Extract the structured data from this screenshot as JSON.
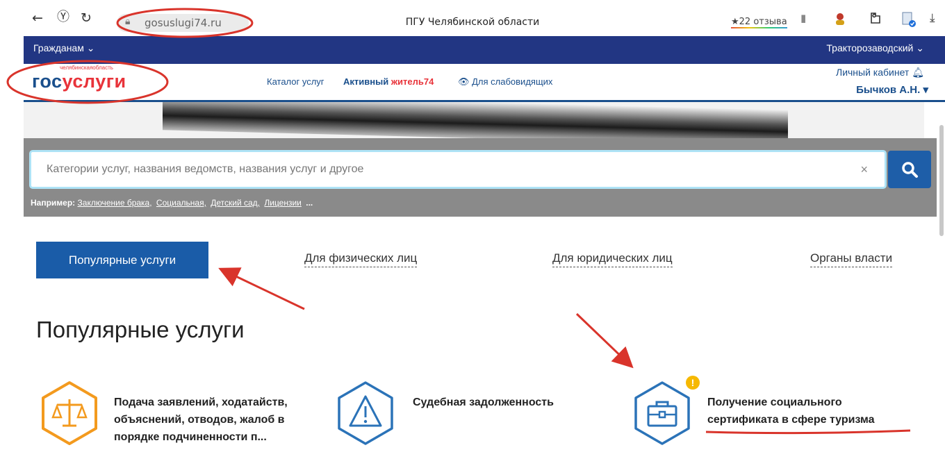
{
  "browser": {
    "url": "gosuslugi74.ru",
    "page_title": "ПГУ Челябинской области",
    "reviews": "★22 отзыва",
    "icons": [
      "back-icon",
      "yandex-icon",
      "reload-icon",
      "lock-icon",
      "bookmark-icon",
      "avatar-icon",
      "extension-icon",
      "profile-icon",
      "download-icon"
    ]
  },
  "nav": {
    "citizens": "Гражданам  ⌄",
    "district": "Тракторозаводский  ⌄"
  },
  "header": {
    "logo_small": "челябинскаяобласть",
    "logo_gos": "гос",
    "logo_uslugi": "услуги",
    "catalog": "Каталог услуг",
    "active_a": "Активный ",
    "active_b": "житель74",
    "vision": "👁 Для слабовидящих",
    "cabinet": "Личный кабинет 🔔︎",
    "username": "Бычков А.Н. ▾"
  },
  "search": {
    "placeholder": "Категории услуг, названия ведомств, названия услуг и другое",
    "clear": "×",
    "examples_label": "Например:",
    "examples": [
      "Заключение брака,",
      "Социальная,",
      "Детский сад,",
      "Лицензии",
      "..."
    ]
  },
  "tabs": {
    "popular": "Популярные услуги",
    "individuals": "Для физических лиц",
    "legal": "Для юридических лиц",
    "authorities": "Органы власти"
  },
  "section": {
    "title": "Популярные услуги",
    "services": [
      {
        "icon": "scales-icon",
        "line1": "Подача заявлений, ходатайств,",
        "line2": "объяснений, отводов, жалоб в",
        "line3": "порядке подчиненности п..."
      },
      {
        "icon": "warning-icon",
        "line1": "Судебная задолженность"
      },
      {
        "icon": "briefcase-icon",
        "line1": "Получение социального",
        "line2": "сертификата в сфере туризма",
        "badge": "!"
      }
    ]
  },
  "colors": {
    "nav_blue": "#223683",
    "brand_blue": "#1a4f8c",
    "brand_red": "#e8333a",
    "search_btn": "#1e5ea8",
    "orange_icon": "#f39a1e",
    "blue_icon": "#2b73b8",
    "annotation_red": "#d9342b"
  }
}
